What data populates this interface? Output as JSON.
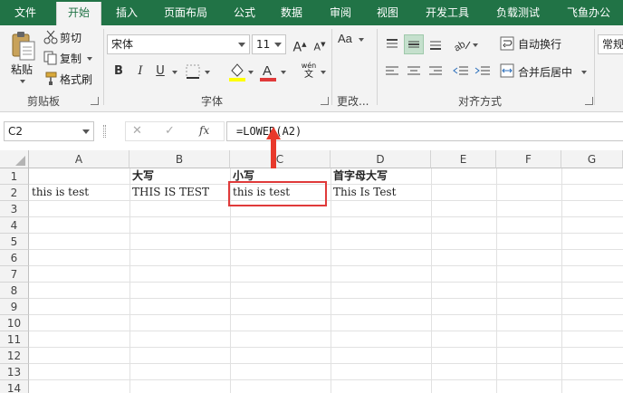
{
  "tabs": [
    "文件",
    "开始",
    "插入",
    "页面布局",
    "公式",
    "数据",
    "审阅",
    "视图",
    "开发工具",
    "负载测试",
    "飞鱼办公"
  ],
  "clipboard": {
    "paste": "粘贴",
    "cut": "剪切",
    "copy": "复制",
    "format_painter": "格式刷",
    "group": "剪贴板"
  },
  "font": {
    "name": "宋体",
    "size": "11",
    "size_up": "A",
    "size_down": "A",
    "bold": "B",
    "italic": "I",
    "underline": "U",
    "phonetic_top": "wén",
    "phonetic_bottom": "文",
    "group": "字体"
  },
  "edit_group": "更改...",
  "alignment": {
    "wrap": "自动换行",
    "merge": "合并后居中",
    "group": "对齐方式"
  },
  "number_format": "常规",
  "formula_bar": {
    "cell_ref": "C2",
    "formula": "=LOWER(A2)",
    "cancel": "✕",
    "enter": "✓",
    "fx": "fx"
  },
  "columns": [
    "A",
    "B",
    "C",
    "D",
    "E",
    "F",
    "G"
  ],
  "rows": [
    "1",
    "2",
    "3",
    "4",
    "5",
    "6",
    "7",
    "8",
    "9",
    "10",
    "11",
    "12",
    "13",
    "14"
  ],
  "cells": {
    "B1": "大写",
    "C1": "小写",
    "D1": "首字母大写",
    "A2": "this is test",
    "B2": "THIS IS TEST",
    "C2": "this is test",
    "D2": "This Is Test"
  },
  "colors": {
    "ribbon_green": "#217346",
    "highlight_red": "#e03a3a",
    "arrow_red": "#e8392b"
  }
}
